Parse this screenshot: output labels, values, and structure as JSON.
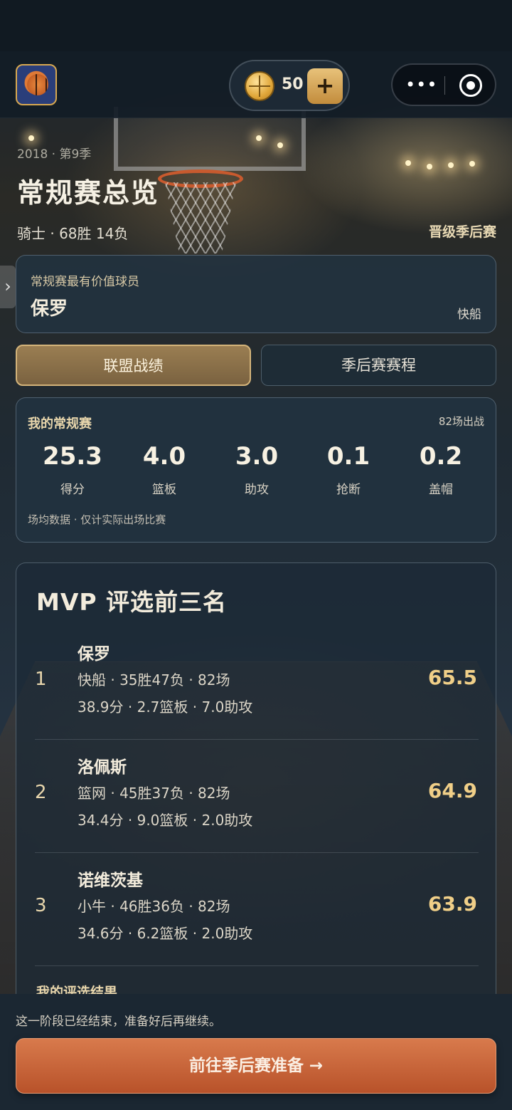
{
  "header": {
    "coin_count": "50",
    "coin_add": "+",
    "capsule_more": "•••",
    "season": "2018 · 第9季",
    "title": "常规赛总览",
    "team_record": "骑士 · 68胜 14负",
    "qualified": "晋级季后赛"
  },
  "mvp": {
    "label": "常规赛最有价值球员",
    "name": "保罗",
    "team": "快船"
  },
  "tabs": {
    "league": "联盟战绩",
    "playoff": "季后赛赛程"
  },
  "stats": {
    "title": "我的常规赛",
    "games": "82场出战",
    "items": [
      {
        "value": "25.3",
        "label": "得分"
      },
      {
        "value": "4.0",
        "label": "篮板"
      },
      {
        "value": "3.0",
        "label": "助攻"
      },
      {
        "value": "0.1",
        "label": "抢断"
      },
      {
        "value": "0.2",
        "label": "盖帽"
      }
    ],
    "note": "场均数据 · 仅计实际出场比赛"
  },
  "ranking": {
    "title": "MVP 评选前三名",
    "rows": [
      {
        "rank": "1",
        "name": "保罗",
        "line1": "快船 · 35胜47负 · 82场",
        "line2": "38.9分 · 2.7篮板 · 7.0助攻",
        "score": "65.5"
      },
      {
        "rank": "2",
        "name": "洛佩斯",
        "line1": "篮网 · 45胜37负 · 82场",
        "line2": "34.4分 · 9.0篮板 · 2.0助攻",
        "score": "64.9"
      },
      {
        "rank": "3",
        "name": "诺维茨基",
        "line1": "小牛 · 46胜36负 · 82场",
        "line2": "34.6分 · 6.2篮板 · 2.0助攻",
        "score": "63.9"
      }
    ],
    "my_result": "我的评选结果"
  },
  "bottom": {
    "note": "这一阶段已经结束，准备好后再继续。",
    "cta": "前往季后赛准备 →"
  },
  "colors": {
    "accent_gold": "#d4b47a",
    "score_gold": "#f0cf88",
    "cta_orange": "#c8623a"
  }
}
